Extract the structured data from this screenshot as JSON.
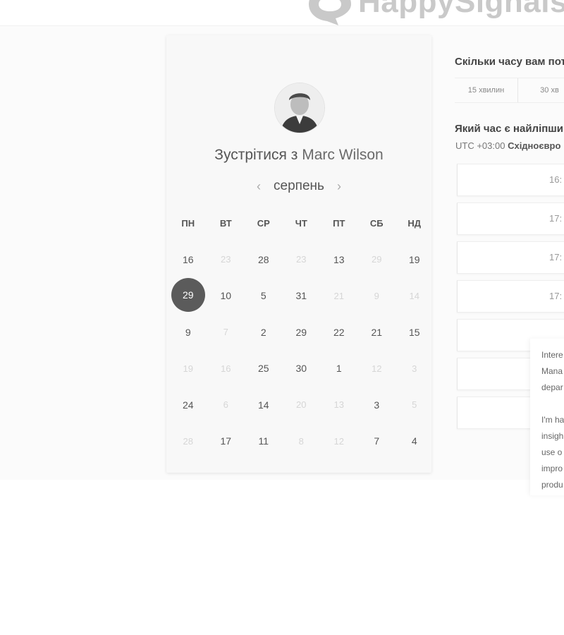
{
  "header": {
    "logo_text": "HappySignals"
  },
  "calendar_card": {
    "meet_prefix": "Зустрітися з",
    "host_name": "Marc Wilson",
    "month": "серпень",
    "prev_icon": "chevron-left-icon",
    "next_icon": "chevron-right-icon",
    "weekdays": [
      "ПН",
      "ВТ",
      "СР",
      "ЧТ",
      "ПТ",
      "СБ",
      "НД"
    ],
    "selected_day": "29",
    "weeks": [
      [
        {
          "d": "16",
          "m": false
        },
        {
          "d": "23",
          "m": true
        },
        {
          "d": "28",
          "m": false
        },
        {
          "d": "23",
          "m": true
        },
        {
          "d": "13",
          "m": false
        },
        {
          "d": "29",
          "m": true
        },
        {
          "d": "19",
          "m": false
        }
      ],
      [
        {
          "d": "29",
          "m": false,
          "sel": true
        },
        {
          "d": "10",
          "m": false
        },
        {
          "d": "5",
          "m": false
        },
        {
          "d": "31",
          "m": false
        },
        {
          "d": "21",
          "m": true
        },
        {
          "d": "9",
          "m": true
        },
        {
          "d": "14",
          "m": true
        }
      ],
      [
        {
          "d": "9",
          "m": false
        },
        {
          "d": "7",
          "m": true
        },
        {
          "d": "2",
          "m": false
        },
        {
          "d": "29",
          "m": false
        },
        {
          "d": "22",
          "m": false
        },
        {
          "d": "21",
          "m": false
        },
        {
          "d": "15",
          "m": false
        }
      ],
      [
        {
          "d": "19",
          "m": true
        },
        {
          "d": "16",
          "m": true
        },
        {
          "d": "25",
          "m": false
        },
        {
          "d": "30",
          "m": false
        },
        {
          "d": "1",
          "m": false
        },
        {
          "d": "12",
          "m": true
        },
        {
          "d": "3",
          "m": true
        }
      ],
      [
        {
          "d": "24",
          "m": false
        },
        {
          "d": "6",
          "m": true
        },
        {
          "d": "14",
          "m": false
        },
        {
          "d": "20",
          "m": true
        },
        {
          "d": "13",
          "m": true
        },
        {
          "d": "3",
          "m": false
        },
        {
          "d": "5",
          "m": true
        }
      ],
      [
        {
          "d": "28",
          "m": true
        },
        {
          "d": "17",
          "m": false
        },
        {
          "d": "11",
          "m": false
        },
        {
          "d": "8",
          "m": true
        },
        {
          "d": "12",
          "m": true
        },
        {
          "d": "7",
          "m": false
        },
        {
          "d": "4",
          "m": false
        }
      ]
    ]
  },
  "booking": {
    "duration_question": "Скільки часу вам пот",
    "durations": [
      "15 хвилин",
      "30 хв"
    ],
    "time_question": "Який час є найліпши",
    "timezone_prefix": "UTC +03:00",
    "timezone_name": "Східноєвро",
    "slots": [
      "16:",
      "17:",
      "17:",
      "17:",
      "",
      "",
      ""
    ]
  },
  "popover": {
    "text_1": "Intere\nMana\ndepar",
    "text_2": "I'm ha\ninsigh\nuse o\nimpro\nprodu"
  },
  "colors": {
    "selected_day_bg": "#5b5b5b",
    "logo": "#c9c9c9"
  }
}
